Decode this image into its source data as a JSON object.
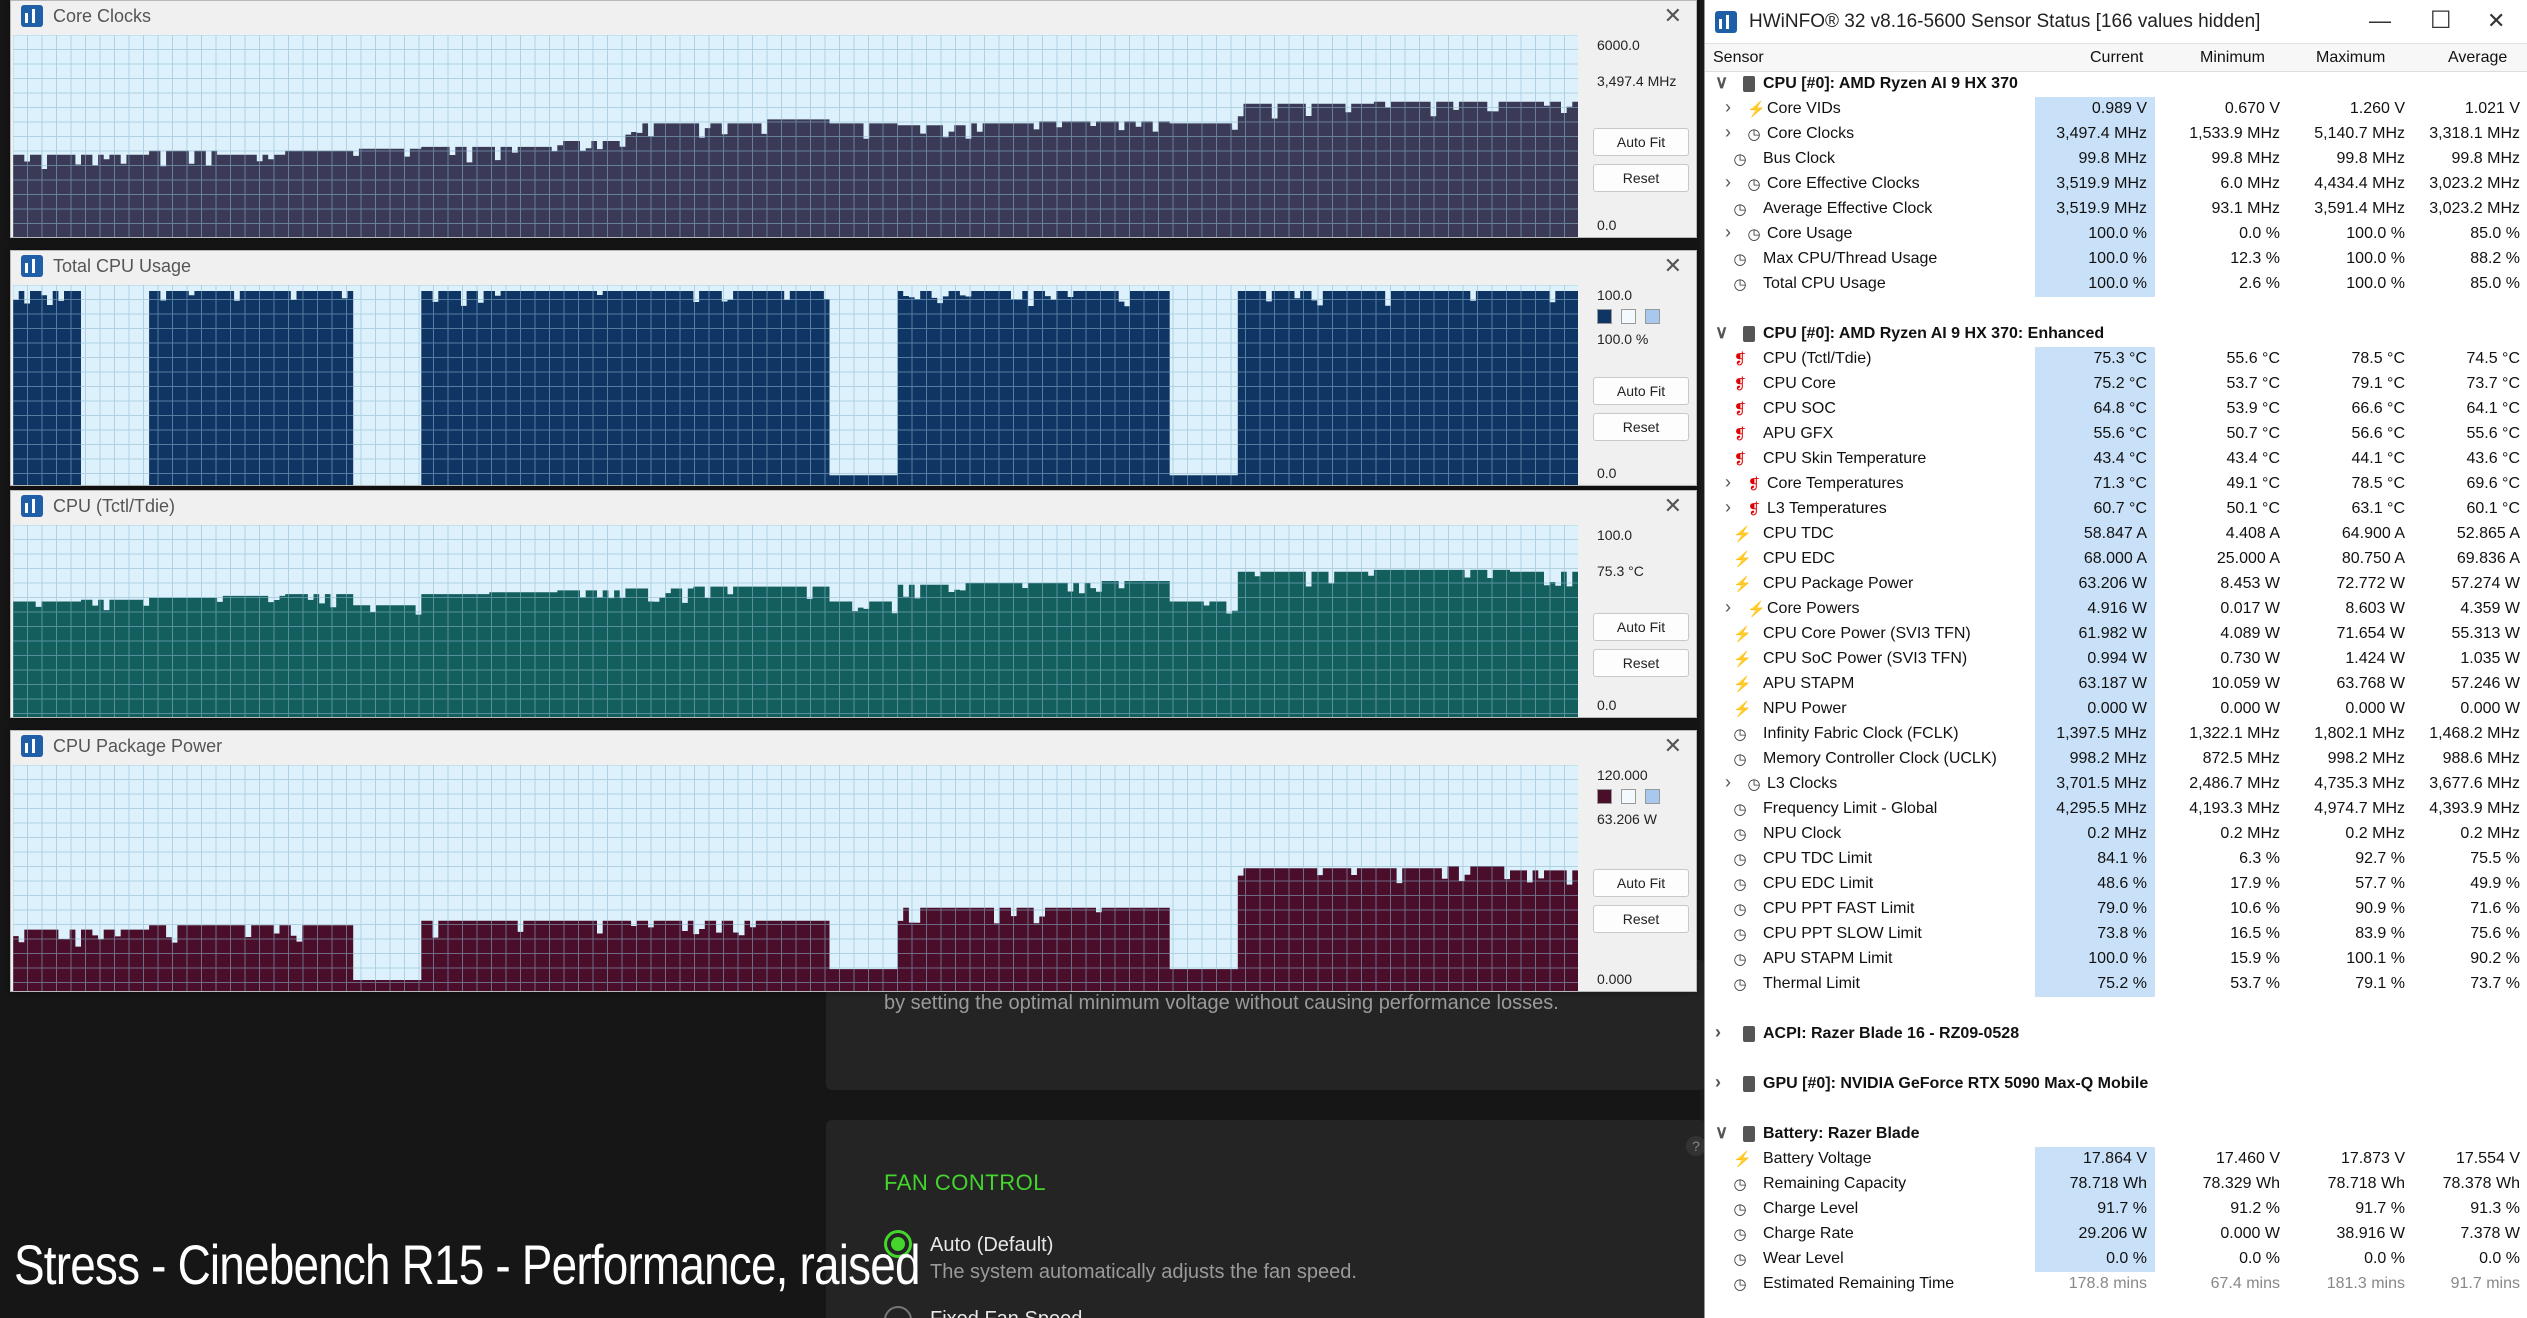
{
  "graphs": [
    {
      "title": "Core Clocks",
      "top_value": "6000.0",
      "cur_value": "3,497.4 MHz",
      "bottom_value": "0.0",
      "auto_fit": "Auto Fit",
      "reset": "Reset",
      "bg": "#dcf1fb",
      "fill": "#3a3a56",
      "grid": "#8fb8d0",
      "level_series": [
        0.42,
        0.42,
        0.44,
        0.42,
        0.44,
        0.45,
        0.46,
        0.46,
        0.49,
        0.58,
        0.58,
        0.6,
        0.58,
        0.57,
        0.58,
        0.59,
        0.59,
        0.58,
        0.68,
        0.68,
        0.69,
        0.69,
        0.69
      ],
      "legend": false
    },
    {
      "title": "Total CPU Usage",
      "top_value": "100.0",
      "cur_value": "100.0 %",
      "bottom_value": "0.0",
      "auto_fit": "Auto Fit",
      "reset": "Reset",
      "bg": "#dcf1fb",
      "fill": "#0e3563",
      "grid": "#8fb8d0",
      "level_series": [
        1.0,
        0.0,
        1.0,
        1.0,
        1.0,
        0.0,
        1.0,
        1.0,
        1.0,
        1.0,
        1.0,
        1.0,
        0.05,
        1.0,
        1.0,
        1.0,
        1.0,
        0.05,
        1.0,
        1.0,
        1.0,
        1.0,
        1.0
      ],
      "legend": true
    },
    {
      "title": "CPU (Tctl/Tdie)",
      "top_value": "100.0",
      "cur_value": "75.3 °C",
      "bottom_value": "0.0",
      "auto_fit": "Auto Fit",
      "reset": "Reset",
      "bg": "#dcf1fb",
      "fill": "#135f5e",
      "grid": "#8fb8d0",
      "level_series": [
        0.62,
        0.63,
        0.64,
        0.65,
        0.66,
        0.6,
        0.66,
        0.67,
        0.68,
        0.69,
        0.7,
        0.7,
        0.62,
        0.71,
        0.72,
        0.72,
        0.73,
        0.62,
        0.78,
        0.78,
        0.79,
        0.79,
        0.78
      ],
      "legend": false
    },
    {
      "title": "CPU Package Power",
      "top_value": "120.000",
      "cur_value": "63.206 W",
      "bottom_value": "0.000",
      "auto_fit": "Auto Fit",
      "reset": "Reset",
      "bg": "#dcf1fb",
      "fill": "#4a0d2a",
      "grid": "#8fb8d0",
      "level_series": [
        0.28,
        0.28,
        0.3,
        0.3,
        0.3,
        0.05,
        0.32,
        0.32,
        0.32,
        0.32,
        0.32,
        0.32,
        0.1,
        0.38,
        0.38,
        0.38,
        0.38,
        0.1,
        0.56,
        0.56,
        0.56,
        0.57,
        0.55
      ],
      "legend": true
    }
  ],
  "background": {
    "text_line": "by setting the optimal minimum voltage without causing performance losses.",
    "fan_title": "FAN CONTROL",
    "fan_auto": "Auto (Default)",
    "fan_auto_desc": "The system automatically adjusts the fan speed.",
    "fan_fixed": "Fixed Fan Speed",
    "caption": "Stress - Cinebench R15 - Performance, raised",
    "accent": "#44d62c"
  },
  "hwinfo": {
    "title": "HWiNFO® 32 v8.16-5600 Sensor Status [166 values hidden]",
    "columns": {
      "sensor": "Sensor",
      "current": "Current",
      "minimum": "Minimum",
      "maximum": "Maximum",
      "average": "Average"
    },
    "rows": [
      {
        "type": "group",
        "name": "CPU [#0]: AMD Ryzen AI 9 HX 370",
        "expanded": true
      },
      {
        "type": "item",
        "icon": "volt",
        "sub": true,
        "name": "Core VIDs",
        "cur": "0.989 V",
        "min": "0.670 V",
        "max": "1.260 V",
        "avg": "1.021 V"
      },
      {
        "type": "item",
        "icon": "clock",
        "sub": true,
        "name": "Core Clocks",
        "cur": "3,497.4 MHz",
        "min": "1,533.9 MHz",
        "max": "5,140.7 MHz",
        "avg": "3,318.1 MHz"
      },
      {
        "type": "item",
        "icon": "clock",
        "sub": false,
        "name": "Bus Clock",
        "cur": "99.8 MHz",
        "min": "99.8 MHz",
        "max": "99.8 MHz",
        "avg": "99.8 MHz"
      },
      {
        "type": "item",
        "icon": "clock",
        "sub": true,
        "name": "Core Effective Clocks",
        "cur": "3,519.9 MHz",
        "min": "6.0 MHz",
        "max": "4,434.4 MHz",
        "avg": "3,023.2 MHz"
      },
      {
        "type": "item",
        "icon": "clock",
        "sub": false,
        "name": "Average Effective Clock",
        "cur": "3,519.9 MHz",
        "min": "93.1 MHz",
        "max": "3,591.4 MHz",
        "avg": "3,023.2 MHz"
      },
      {
        "type": "item",
        "icon": "clock",
        "sub": true,
        "name": "Core Usage",
        "cur": "100.0 %",
        "min": "0.0 %",
        "max": "100.0 %",
        "avg": "85.0 %"
      },
      {
        "type": "item",
        "icon": "clock",
        "sub": false,
        "name": "Max CPU/Thread Usage",
        "cur": "100.0 %",
        "min": "12.3 %",
        "max": "100.0 %",
        "avg": "88.2 %"
      },
      {
        "type": "item",
        "icon": "clock",
        "sub": false,
        "name": "Total CPU Usage",
        "cur": "100.0 %",
        "min": "2.6 %",
        "max": "100.0 %",
        "avg": "85.0 %"
      },
      {
        "type": "spacer"
      },
      {
        "type": "group",
        "name": "CPU [#0]: AMD Ryzen AI 9 HX 370: Enhanced",
        "expanded": true
      },
      {
        "type": "item",
        "icon": "temp",
        "sub": false,
        "name": "CPU (Tctl/Tdie)",
        "cur": "75.3 °C",
        "min": "55.6 °C",
        "max": "78.5 °C",
        "avg": "74.5 °C"
      },
      {
        "type": "item",
        "icon": "temp",
        "sub": false,
        "name": "CPU Core",
        "cur": "75.2 °C",
        "min": "53.7 °C",
        "max": "79.1 °C",
        "avg": "73.7 °C"
      },
      {
        "type": "item",
        "icon": "temp",
        "sub": false,
        "name": "CPU SOC",
        "cur": "64.8 °C",
        "min": "53.9 °C",
        "max": "66.6 °C",
        "avg": "64.1 °C"
      },
      {
        "type": "item",
        "icon": "temp",
        "sub": false,
        "name": "APU GFX",
        "cur": "55.6 °C",
        "min": "50.7 °C",
        "max": "56.6 °C",
        "avg": "55.6 °C"
      },
      {
        "type": "item",
        "icon": "temp",
        "sub": false,
        "name": "CPU Skin Temperature",
        "cur": "43.4 °C",
        "min": "43.4 °C",
        "max": "44.1 °C",
        "avg": "43.6 °C"
      },
      {
        "type": "item",
        "icon": "temp",
        "sub": true,
        "name": "Core Temperatures",
        "cur": "71.3 °C",
        "min": "49.1 °C",
        "max": "78.5 °C",
        "avg": "69.6 °C"
      },
      {
        "type": "item",
        "icon": "temp",
        "sub": true,
        "name": "L3 Temperatures",
        "cur": "60.7 °C",
        "min": "50.1 °C",
        "max": "63.1 °C",
        "avg": "60.1 °C"
      },
      {
        "type": "item",
        "icon": "volt",
        "sub": false,
        "name": "CPU TDC",
        "cur": "58.847 A",
        "min": "4.408 A",
        "max": "64.900 A",
        "avg": "52.865 A"
      },
      {
        "type": "item",
        "icon": "volt",
        "sub": false,
        "name": "CPU EDC",
        "cur": "68.000 A",
        "min": "25.000 A",
        "max": "80.750 A",
        "avg": "69.836 A"
      },
      {
        "type": "item",
        "icon": "volt",
        "sub": false,
        "name": "CPU Package Power",
        "cur": "63.206 W",
        "min": "8.453 W",
        "max": "72.772 W",
        "avg": "57.274 W"
      },
      {
        "type": "item",
        "icon": "volt",
        "sub": true,
        "name": "Core Powers",
        "cur": "4.916 W",
        "min": "0.017 W",
        "max": "8.603 W",
        "avg": "4.359 W"
      },
      {
        "type": "item",
        "icon": "volt",
        "sub": false,
        "name": "CPU Core Power (SVI3 TFN)",
        "cur": "61.982 W",
        "min": "4.089 W",
        "max": "71.654 W",
        "avg": "55.313 W"
      },
      {
        "type": "item",
        "icon": "volt",
        "sub": false,
        "name": "CPU SoC Power (SVI3 TFN)",
        "cur": "0.994 W",
        "min": "0.730 W",
        "max": "1.424 W",
        "avg": "1.035 W"
      },
      {
        "type": "item",
        "icon": "volt",
        "sub": false,
        "name": "APU STAPM",
        "cur": "63.187 W",
        "min": "10.059 W",
        "max": "63.768 W",
        "avg": "57.246 W"
      },
      {
        "type": "item",
        "icon": "volt",
        "sub": false,
        "name": "NPU Power",
        "cur": "0.000 W",
        "min": "0.000 W",
        "max": "0.000 W",
        "avg": "0.000 W"
      },
      {
        "type": "item",
        "icon": "clock",
        "sub": false,
        "name": "Infinity Fabric Clock (FCLK)",
        "cur": "1,397.5 MHz",
        "min": "1,322.1 MHz",
        "max": "1,802.1 MHz",
        "avg": "1,468.2 MHz"
      },
      {
        "type": "item",
        "icon": "clock",
        "sub": false,
        "name": "Memory Controller Clock (UCLK)",
        "cur": "998.2 MHz",
        "min": "872.5 MHz",
        "max": "998.2 MHz",
        "avg": "988.6 MHz"
      },
      {
        "type": "item",
        "icon": "clock",
        "sub": true,
        "name": "L3 Clocks",
        "cur": "3,701.5 MHz",
        "min": "2,486.7 MHz",
        "max": "4,735.3 MHz",
        "avg": "3,677.6 MHz"
      },
      {
        "type": "item",
        "icon": "clock",
        "sub": false,
        "name": "Frequency Limit - Global",
        "cur": "4,295.5 MHz",
        "min": "4,193.3 MHz",
        "max": "4,974.7 MHz",
        "avg": "4,393.9 MHz"
      },
      {
        "type": "item",
        "icon": "clock",
        "sub": false,
        "name": "NPU Clock",
        "cur": "0.2 MHz",
        "min": "0.2 MHz",
        "max": "0.2 MHz",
        "avg": "0.2 MHz"
      },
      {
        "type": "item",
        "icon": "clock",
        "sub": false,
        "name": "CPU TDC Limit",
        "cur": "84.1 %",
        "min": "6.3 %",
        "max": "92.7 %",
        "avg": "75.5 %"
      },
      {
        "type": "item",
        "icon": "clock",
        "sub": false,
        "name": "CPU EDC Limit",
        "cur": "48.6 %",
        "min": "17.9 %",
        "max": "57.7 %",
        "avg": "49.9 %"
      },
      {
        "type": "item",
        "icon": "clock",
        "sub": false,
        "name": "CPU PPT FAST Limit",
        "cur": "79.0 %",
        "min": "10.6 %",
        "max": "90.9 %",
        "avg": "71.6 %"
      },
      {
        "type": "item",
        "icon": "clock",
        "sub": false,
        "name": "CPU PPT SLOW Limit",
        "cur": "73.8 %",
        "min": "16.5 %",
        "max": "83.9 %",
        "avg": "75.6 %"
      },
      {
        "type": "item",
        "icon": "clock",
        "sub": false,
        "name": "APU STAPM Limit",
        "cur": "100.0 %",
        "min": "15.9 %",
        "max": "100.1 %",
        "avg": "90.2 %"
      },
      {
        "type": "item",
        "icon": "clock",
        "sub": false,
        "name": "Thermal Limit",
        "cur": "75.2 %",
        "min": "53.7 %",
        "max": "79.1 %",
        "avg": "73.7 %"
      },
      {
        "type": "spacer"
      },
      {
        "type": "group",
        "name": "ACPI: Razer Blade 16 - RZ09-0528",
        "expanded": false
      },
      {
        "type": "spacer"
      },
      {
        "type": "group",
        "name": "GPU [#0]: NVIDIA  GeForce RTX 5090 Max-Q Mobile",
        "expanded": false
      },
      {
        "type": "spacer"
      },
      {
        "type": "group",
        "name": "Battery: Razer Blade",
        "expanded": true
      },
      {
        "type": "item",
        "icon": "volt",
        "sub": false,
        "name": "Battery Voltage",
        "cur": "17.864 V",
        "min": "17.460 V",
        "max": "17.873 V",
        "avg": "17.554 V"
      },
      {
        "type": "item",
        "icon": "clock",
        "sub": false,
        "name": "Remaining Capacity",
        "cur": "78.718 Wh",
        "min": "78.329 Wh",
        "max": "78.718 Wh",
        "avg": "78.378 Wh"
      },
      {
        "type": "item",
        "icon": "clock",
        "sub": false,
        "name": "Charge Level",
        "cur": "91.7 %",
        "min": "91.2 %",
        "max": "91.7 %",
        "avg": "91.3 %"
      },
      {
        "type": "item",
        "icon": "clock",
        "sub": false,
        "name": "Charge Rate",
        "cur": "29.206 W",
        "min": "0.000 W",
        "max": "38.916 W",
        "avg": "7.378 W"
      },
      {
        "type": "item",
        "icon": "clock",
        "sub": false,
        "name": "Wear Level",
        "cur": "0.0 %",
        "min": "0.0 %",
        "max": "0.0 %",
        "avg": "0.0 %"
      },
      {
        "type": "item",
        "icon": "clock",
        "sub": false,
        "name": "Estimated Remaining Time",
        "cur": "178.8 mins",
        "min": "67.4 mins",
        "max": "181.3 mins",
        "avg": "91.7 mins",
        "grey": true
      }
    ]
  }
}
